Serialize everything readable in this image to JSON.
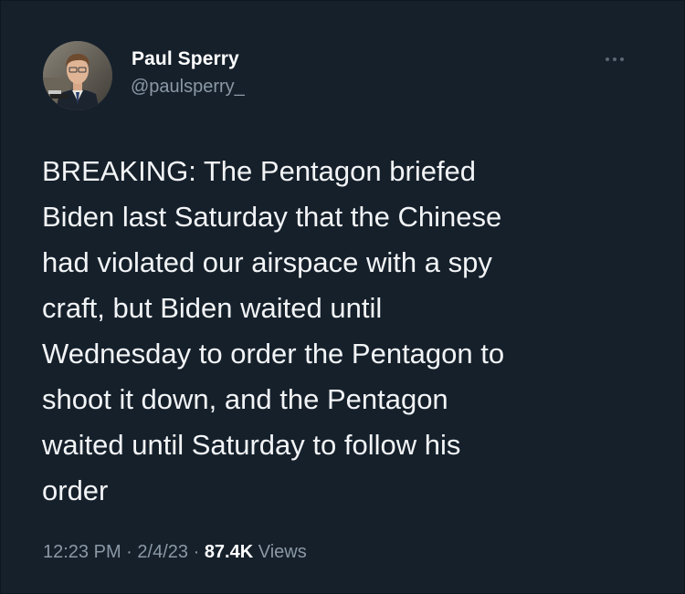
{
  "author": {
    "name": "Paul Sperry",
    "handle": "@paulsperry_",
    "avatar_icon": "profile-photo-icon"
  },
  "more_icon": "more-options-icon",
  "tweet": {
    "text": "BREAKING: The Pentagon briefed\nBiden last Saturday that the Chinese\nhad violated our airspace with a spy\ncraft, but Biden waited until\nWednesday to order the Pentagon to\nshoot it down, and the Pentagon\nwaited until Saturday to follow his\norder"
  },
  "meta": {
    "time": "12:23 PM",
    "separator": "·",
    "date": "2/4/23",
    "views_count": "87.4K",
    "views_label": "Views"
  },
  "colors": {
    "background": "#15202b",
    "text": "#f2f4f6",
    "secondary": "#8b98a5"
  }
}
